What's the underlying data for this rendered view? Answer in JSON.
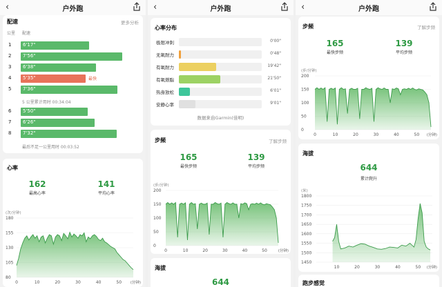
{
  "nav_title": "户外跑",
  "p1": {
    "pace_title": "配速",
    "more": "更多分析",
    "col_km": "公里",
    "col_pace": "配速",
    "laps": [
      {
        "n": "1",
        "pace": "6'17\"",
        "frac": 0.6
      },
      {
        "n": "2",
        "pace": "7'56\"",
        "frac": 0.89
      },
      {
        "n": "3",
        "pace": "6'38\"",
        "frac": 0.66
      },
      {
        "n": "4",
        "pace": "5'35\"",
        "frac": 0.57,
        "fast": true,
        "tag": "最快"
      },
      {
        "n": "5",
        "pace": "7'36\"",
        "frac": 0.85
      }
    ],
    "note1": "5 公里累计用时 00:34:04",
    "laps2": [
      {
        "n": "6",
        "pace": "5'50\"",
        "frac": 0.59
      },
      {
        "n": "7",
        "pace": "6'26\"",
        "frac": 0.65
      },
      {
        "n": "8",
        "pace": "7'32\"",
        "frac": 0.84
      }
    ],
    "note2": "最后不足一公里用时 00:03:52",
    "hr_title": "心率",
    "hr_max": "162",
    "hr_max_label": "最高心率",
    "hr_avg": "141",
    "hr_avg_label": "平均心率"
  },
  "p2": {
    "zone_title": "心率分布",
    "zones": [
      {
        "name": "极限冲刺",
        "time": "0'00\"",
        "frac": 0.0,
        "color": "#e05a4f"
      },
      {
        "name": "无氧耐力",
        "time": "0'48\"",
        "frac": 0.02,
        "color": "#f0a03c"
      },
      {
        "name": "有氧耐力",
        "time": "19'42\"",
        "frac": 0.45,
        "color": "#ecd060"
      },
      {
        "name": "有氧燃脂",
        "time": "21'50\"",
        "frac": 0.5,
        "color": "#9dd264"
      },
      {
        "name": "热身放松",
        "time": "6'01\"",
        "frac": 0.13,
        "color": "#3ec69a"
      },
      {
        "name": "安静心率",
        "time": "9'01\"",
        "frac": 0.2,
        "color": "#e0e0e0"
      }
    ],
    "source": "数据来自Garmin(佳明)",
    "cad_title": "步频",
    "learn": "了解步频",
    "cad_max": "165",
    "cad_max_label": "最快步频",
    "cad_avg": "139",
    "cad_avg_label": "平均步频",
    "alt_title": "海拔",
    "alt_value": "644"
  },
  "p3": {
    "cad_title": "步频",
    "learn": "了解步频",
    "cad_max": "165",
    "cad_max_label": "最快步频",
    "cad_avg": "139",
    "cad_avg_label": "平均步频",
    "alt_title": "海拔",
    "alt_value": "644",
    "alt_label": "累计爬升",
    "feel_title": "跑步感觉"
  },
  "chart_data": [
    {
      "type": "area",
      "title": "心率",
      "ylabel": "(次/分钟)",
      "xlabel": "(分钟)",
      "ylim": [
        80,
        180
      ],
      "xlim": [
        0,
        57
      ],
      "yticks": [
        "180",
        "155",
        "130",
        "105",
        "80"
      ],
      "xticks": [
        "0",
        "10",
        "20",
        "30",
        "40",
        "50"
      ],
      "color": "#4caf50",
      "x": [
        0,
        1,
        2,
        3,
        4,
        5,
        6,
        7,
        8,
        9,
        10,
        11,
        12,
        13,
        14,
        15,
        16,
        17,
        18,
        19,
        20,
        21,
        22,
        23,
        24,
        25,
        26,
        27,
        28,
        29,
        30,
        31,
        32,
        33,
        34,
        35,
        36,
        37,
        38,
        39,
        40,
        41,
        42,
        43,
        44,
        45,
        46,
        47,
        48,
        49,
        50,
        51,
        52,
        53,
        54,
        55,
        56,
        57
      ],
      "y": [
        100,
        112,
        128,
        138,
        146,
        150,
        143,
        148,
        152,
        146,
        150,
        140,
        148,
        150,
        138,
        146,
        152,
        150,
        136,
        148,
        152,
        150,
        142,
        154,
        150,
        145,
        156,
        148,
        153,
        150,
        146,
        152,
        150,
        155,
        140,
        148,
        145,
        150,
        152,
        149,
        144,
        142,
        146,
        140,
        138,
        135,
        132,
        130,
        128,
        122,
        118,
        114,
        110,
        108,
        104,
        100,
        96,
        93
      ]
    },
    {
      "type": "area",
      "title": "步频",
      "ylabel": "(步/分钟)",
      "xlabel": "(分钟)",
      "ylim": [
        0,
        200
      ],
      "xlim": [
        0,
        57
      ],
      "yticks": [
        "200",
        "150",
        "100",
        "50",
        "0"
      ],
      "xticks": [
        "0",
        "10",
        "20",
        "30",
        "40",
        "50"
      ],
      "color": "#4caf50",
      "x": [
        0,
        1,
        2,
        3,
        4,
        5,
        6,
        7,
        8,
        9,
        10,
        11,
        12,
        13,
        14,
        15,
        16,
        17,
        18,
        19,
        20,
        21,
        22,
        23,
        24,
        25,
        26,
        27,
        28,
        29,
        30,
        31,
        32,
        33,
        34,
        35,
        36,
        37,
        38,
        39,
        40,
        41,
        42,
        43,
        44,
        45,
        46,
        47,
        48,
        49,
        50,
        51,
        52,
        53,
        54,
        55,
        56,
        57
      ],
      "y": [
        150,
        156,
        150,
        155,
        150,
        156,
        30,
        150,
        154,
        150,
        155,
        20,
        150,
        156,
        150,
        152,
        60,
        150,
        154,
        150,
        150,
        154,
        40,
        150,
        150,
        156,
        152,
        150,
        154,
        30,
        150,
        156,
        152,
        150,
        155,
        150,
        150,
        100,
        152,
        150,
        155,
        152,
        130,
        150,
        152,
        150,
        154,
        150,
        155,
        150,
        148,
        152,
        150,
        148,
        140,
        130,
        100,
        10
      ]
    },
    {
      "type": "area",
      "title": "海拔",
      "ylabel": "(米)",
      "xlabel": "(分钟)",
      "ylim": [
        1450,
        1800
      ],
      "xlim": [
        0,
        57
      ],
      "yticks": [
        "1800",
        "1750",
        "1700",
        "1650",
        "1600",
        "1550",
        "1500",
        "1450"
      ],
      "xticks": [
        "10",
        "20",
        "30",
        "40",
        "50"
      ],
      "color": "#4caf50",
      "x": [
        8,
        9,
        10,
        11,
        12,
        14,
        16,
        18,
        20,
        22,
        24,
        26,
        28,
        30,
        32,
        34,
        36,
        38,
        40,
        42,
        44,
        46,
        48,
        49,
        50,
        51,
        52,
        53,
        54,
        55,
        56
      ],
      "y": [
        1560,
        1580,
        1650,
        1560,
        1520,
        1525,
        1535,
        1530,
        1540,
        1548,
        1545,
        1535,
        1528,
        1520,
        1518,
        1522,
        1530,
        1528,
        1525,
        1540,
        1535,
        1550,
        1530,
        1570,
        1680,
        1760,
        1710,
        1560,
        1530,
        1520,
        1515
      ]
    }
  ]
}
